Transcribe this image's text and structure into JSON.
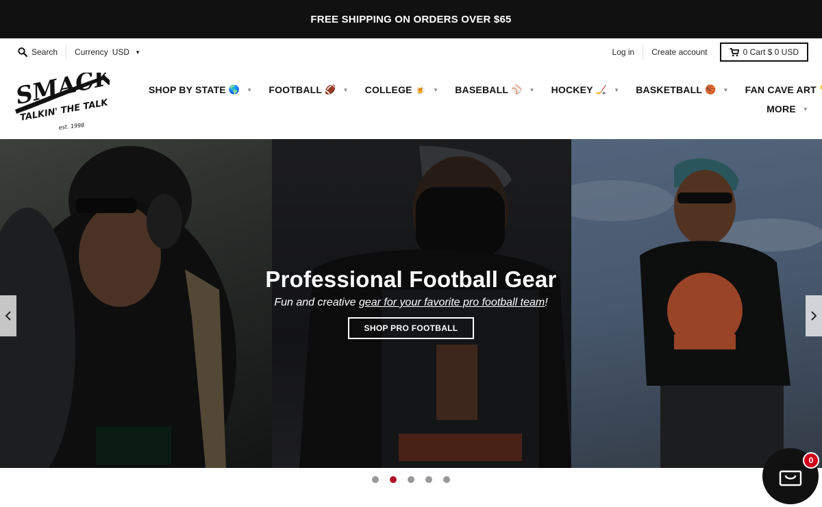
{
  "announcement": "FREE SHIPPING ON ORDERS OVER $65",
  "utility": {
    "search_label": "Search",
    "currency_label": "Currency",
    "currency_value": "USD",
    "login": "Log in",
    "create_account": "Create account",
    "cart": "0 Cart $ 0 USD"
  },
  "logo": {
    "main": "SMACK",
    "tagline": "TALKIN' THE TALK",
    "est": "est. 1998"
  },
  "nav": {
    "items": [
      {
        "label": "SHOP BY STATE",
        "emoji": "🌎"
      },
      {
        "label": "FOOTBALL",
        "emoji": "🏈"
      },
      {
        "label": "COLLEGE",
        "emoji": "🍺"
      },
      {
        "label": "BASEBALL",
        "emoji": "⚾"
      },
      {
        "label": "HOCKEY",
        "emoji": "🏒"
      },
      {
        "label": "BASKETBALL",
        "emoji": "🏀"
      },
      {
        "label": "FAN CAVE ART",
        "emoji": "👎"
      }
    ],
    "more": "MORE"
  },
  "hero": {
    "title": "Professional Football Gear",
    "subtitle_plain": "Fun and creative ",
    "subtitle_link": "gear for your favorite pro football team",
    "subtitle_end": "!",
    "button": "SHOP PRO FOOTBALL",
    "prev_icon": "chevron-left-icon",
    "next_icon": "chevron-right-icon"
  },
  "slider": {
    "count": 5,
    "active_index": 1,
    "active_color": "#b0102a"
  },
  "floating_cart": {
    "badge": "0",
    "icon": "shopping-bag-icon"
  },
  "colors": {
    "top_bar": "#111111",
    "badge": "#d0021b"
  }
}
